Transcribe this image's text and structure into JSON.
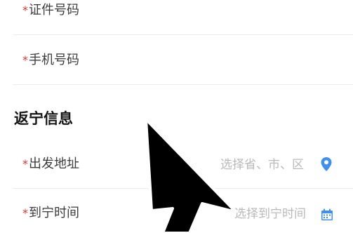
{
  "form": {
    "id_number": {
      "required_mark": "*",
      "label": "证件号码"
    },
    "phone_number": {
      "required_mark": "*",
      "label": "手机号码"
    },
    "section_title": "返宁信息",
    "departure_address": {
      "required_mark": "*",
      "label": "出发地址",
      "placeholder": "选择省、市、区",
      "icon": "location-pin-icon"
    },
    "arrival_time": {
      "required_mark": "*",
      "label": "到宁时间",
      "placeholder": "选择到宁时间",
      "icon": "calendar-icon"
    }
  },
  "colors": {
    "required": "#d9362b",
    "label": "#3b3b3b",
    "placeholder": "#b9b9b9",
    "accent": "#3f8ff0"
  }
}
